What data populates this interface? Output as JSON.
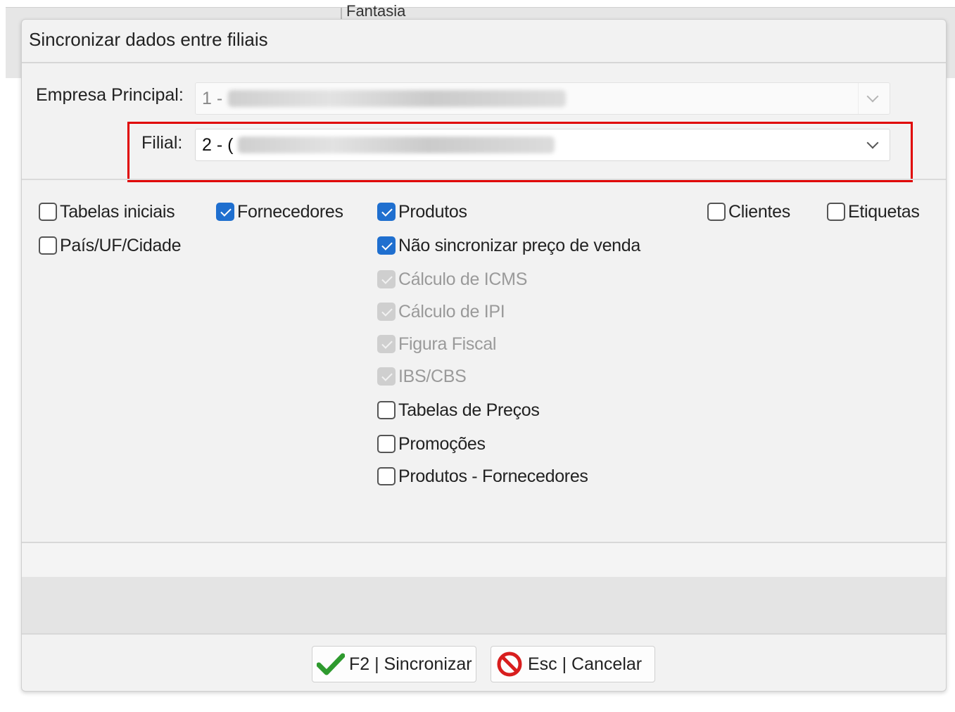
{
  "background": {
    "tab_text": "Fantasia"
  },
  "dialog": {
    "title": "Sincronizar dados entre filiais",
    "empresa": {
      "label": "Empresa Principal:",
      "value": "1 -"
    },
    "filial": {
      "label": "Filial:",
      "value": "2 - ("
    },
    "checkboxes": {
      "tabelas_iniciais": {
        "label": "Tabelas iniciais",
        "checked": false
      },
      "pais_uf_cidade": {
        "label": "País/UF/Cidade",
        "checked": false
      },
      "fornecedores": {
        "label": "Fornecedores",
        "checked": true
      },
      "produtos": {
        "label": "Produtos",
        "checked": true
      },
      "nao_sincronizar_preco": {
        "label": "Não sincronizar preço de venda",
        "checked": true
      },
      "calculo_icms": {
        "label": "Cálculo de ICMS",
        "checked": true,
        "disabled": true
      },
      "calculo_ipi": {
        "label": "Cálculo de IPI",
        "checked": true,
        "disabled": true
      },
      "figura_fiscal": {
        "label": "Figura Fiscal",
        "checked": true,
        "disabled": true
      },
      "ibs_cbs": {
        "label": "IBS/CBS",
        "checked": true,
        "disabled": true
      },
      "tabelas_precos": {
        "label": "Tabelas de Preços",
        "checked": false
      },
      "promocoes": {
        "label": "Promoções",
        "checked": false
      },
      "produtos_fornecedores": {
        "label": "Produtos - Fornecedores",
        "checked": false
      },
      "clientes": {
        "label": "Clientes",
        "checked": false
      },
      "etiquetas": {
        "label": "Etiquetas",
        "checked": false
      }
    },
    "buttons": {
      "sync_label": "F2 | Sincronizar",
      "cancel_label": "Esc | Cancelar"
    }
  },
  "colors": {
    "accent": "#1f6fcf",
    "highlight": "#e00000",
    "ok": "#2e9a2e",
    "cancel": "#d81e1e"
  }
}
